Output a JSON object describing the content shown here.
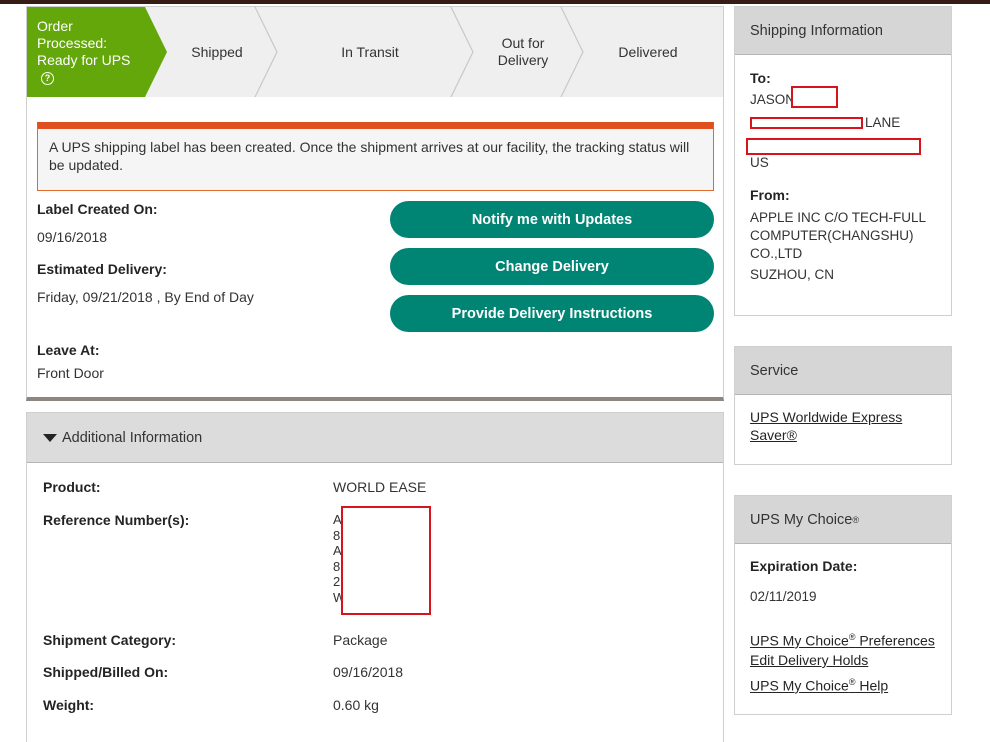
{
  "progress": {
    "steps": [
      {
        "line1": "Order Processed:",
        "line2": "Ready for UPS",
        "active": true
      },
      {
        "line1": "Shipped",
        "line2": ""
      },
      {
        "line1": "In Transit",
        "line2": ""
      },
      {
        "line1": "Out for",
        "line2": "Delivery"
      },
      {
        "line1": "Delivered",
        "line2": ""
      }
    ],
    "help_glyph": "?",
    "active_color": "#64a70b"
  },
  "alert": {
    "message": "A UPS shipping label has been created. Once the shipment arrives at our facility, the tracking status will be updated."
  },
  "details": {
    "label_created_label": "Label Created On:",
    "label_created_value": "09/16/2018",
    "estimated_delivery_label": "Estimated Delivery:",
    "estimated_delivery_value": "Friday, 09/21/2018 , By End of Day",
    "leave_at_label": "Leave At:",
    "leave_at_value": "Front Door"
  },
  "buttons": {
    "notify": "Notify me with Updates",
    "change": "Change Delivery",
    "instructions": "Provide Delivery Instructions",
    "color": "#008473"
  },
  "additional": {
    "header": "Additional Information",
    "product_label": "Product:",
    "product_value": "WORLD EASE",
    "reference_label": "Reference Number(s):",
    "reference_values": [
      "A",
      "8",
      "A",
      "8",
      "2",
      "W"
    ],
    "category_label": "Shipment Category:",
    "category_value": "Package",
    "billed_label": "Shipped/Billed On:",
    "billed_value": "09/16/2018",
    "weight_label": "Weight:",
    "weight_value": "0.60 kg"
  },
  "shipping_info": {
    "header": "Shipping Information",
    "to_label": "To:",
    "to_name": "JASON",
    "to_street": "LANE",
    "to_country": "US",
    "from_label": "From:",
    "from_line1": "APPLE INC C/O TECH-FULL",
    "from_line2": "COMPUTER(CHANGSHU)",
    "from_line3": "CO.,LTD",
    "from_city": "SUZHOU,  CN"
  },
  "service": {
    "header": "Service",
    "link_line1": "UPS Worldwide Express",
    "link_line2": "Saver®"
  },
  "my_choice": {
    "header": "UPS My Choice",
    "reg": "®",
    "expiration_label": "Expiration Date:",
    "expiration_value": "02/11/2019",
    "preferences_prefix": "UPS My Choice",
    "preferences_suffix": " Preferences",
    "edit_holds": "Edit Delivery Holds",
    "help_prefix": "UPS My Choice",
    "help_suffix": " Help"
  },
  "colors": {
    "brand_brown": "#351c15",
    "alert_orange": "#e04f1e",
    "redaction_red": "#d8131b"
  }
}
